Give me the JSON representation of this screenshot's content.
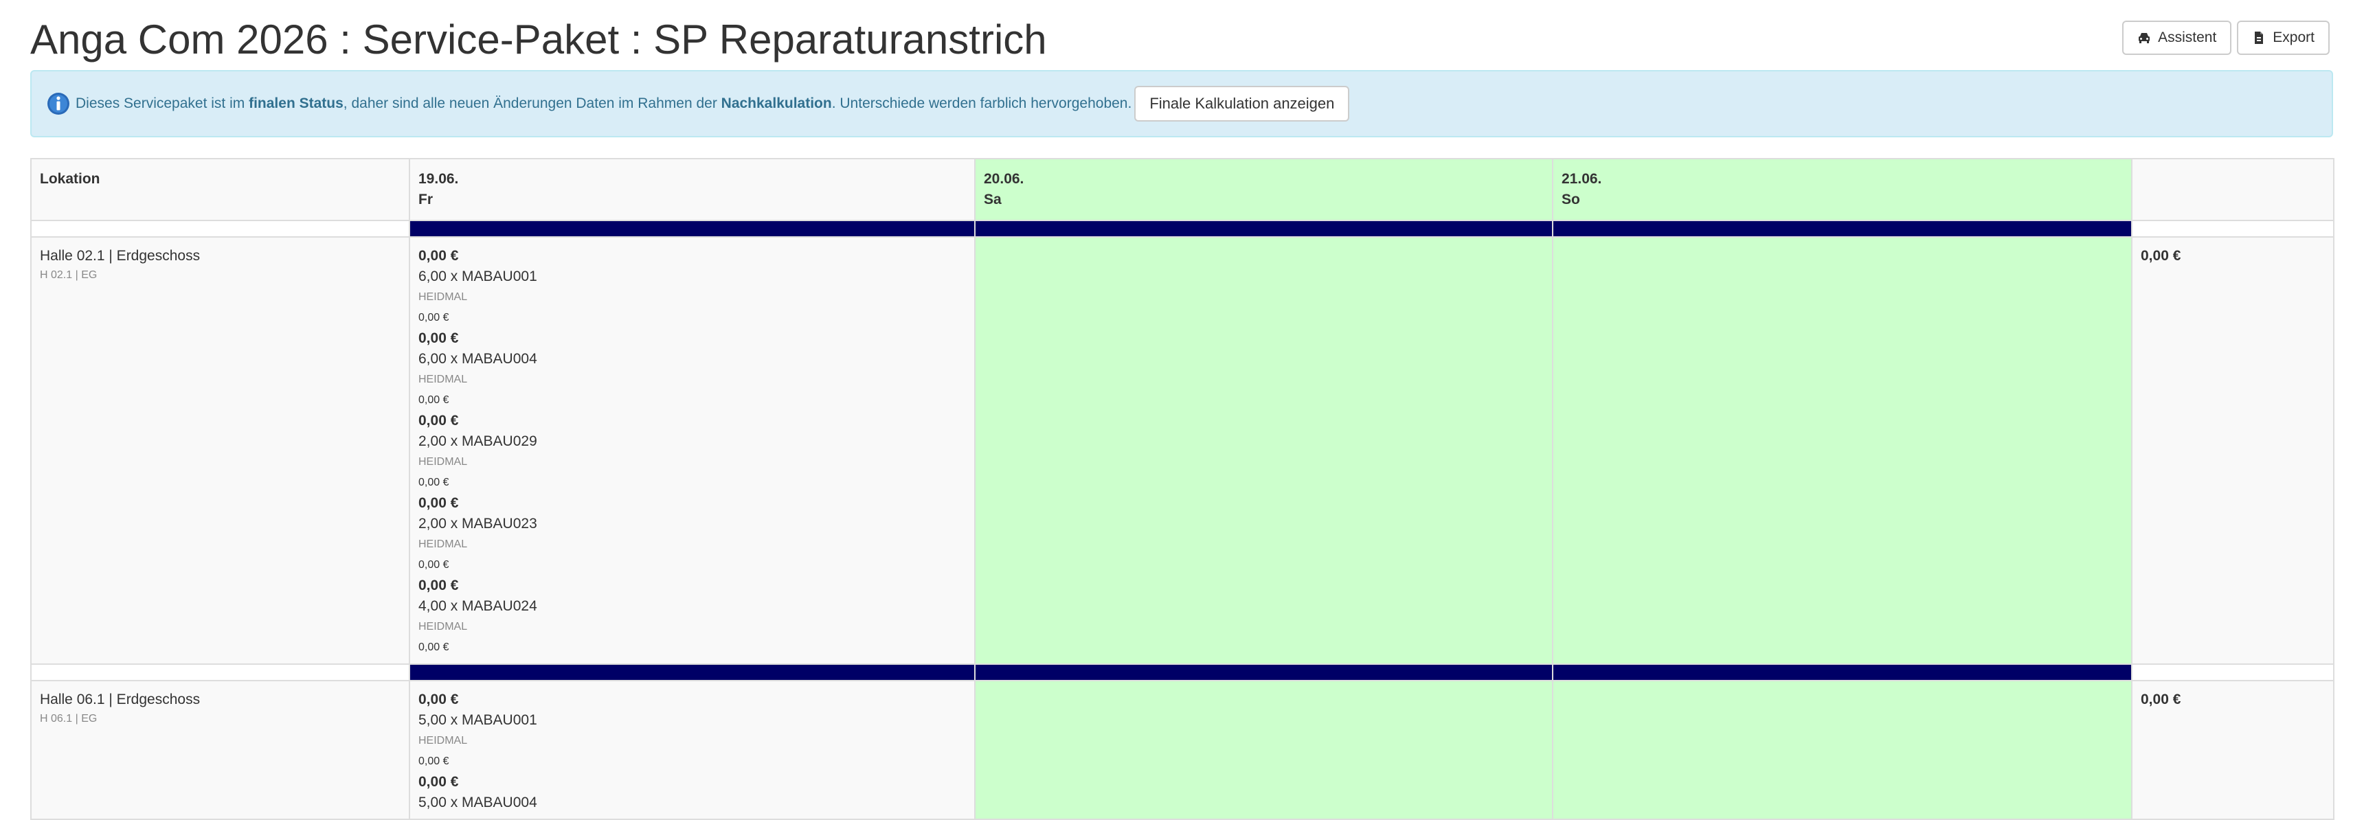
{
  "header": {
    "title": "Anga Com 2026 : Service-Paket : SP Reparaturanstrich",
    "buttons": [
      {
        "label": "Assistent",
        "icon": "car-icon"
      },
      {
        "label": "Export",
        "icon": "file-export-icon"
      }
    ]
  },
  "alert": {
    "icon": "info-icon",
    "text_1": "Dieses Servicepaket ist im ",
    "bold_1": "finalen Status",
    "text_2": ", daher sind alle neuen Änderungen Daten im Rahmen der ",
    "bold_2": "Nachkalkulation",
    "text_3": ". Unterschiede werden farblich hervorgehoben.",
    "button": "Finale Kalkulation anzeigen"
  },
  "table": {
    "location_header": "Lokation",
    "days": [
      {
        "date": "19.06.",
        "weekday": "Fr",
        "highlight": false
      },
      {
        "date": "20.06.",
        "weekday": "Sa",
        "highlight": true
      },
      {
        "date": "21.06.",
        "weekday": "So",
        "highlight": true
      }
    ],
    "colors": {
      "green": "#ccffcc",
      "bar": "#000066",
      "info_bg": "#d9edf7",
      "info_text": "#31708f"
    },
    "locations": [
      {
        "name": "Halle 02.1 | Erdgeschoss",
        "code": "H 02.1 | EG",
        "total": "0,00 €",
        "items": [
          {
            "price": "0,00 €",
            "qty": "6,00 x MABAU001",
            "vendor": "HEIDMAL",
            "sub": "0,00 €"
          },
          {
            "price": "0,00 €",
            "qty": "6,00 x MABAU004",
            "vendor": "HEIDMAL",
            "sub": "0,00 €"
          },
          {
            "price": "0,00 €",
            "qty": "2,00 x MABAU029",
            "vendor": "HEIDMAL",
            "sub": "0,00 €"
          },
          {
            "price": "0,00 €",
            "qty": "2,00 x MABAU023",
            "vendor": "HEIDMAL",
            "sub": "0,00 €"
          },
          {
            "price": "0,00 €",
            "qty": "4,00 x MABAU024",
            "vendor": "HEIDMAL",
            "sub": "0,00 €"
          }
        ]
      },
      {
        "name": "Halle 06.1 | Erdgeschoss",
        "code": "H 06.1 | EG",
        "total": "0,00 €",
        "items": [
          {
            "price": "0,00 €",
            "qty": "5,00 x MABAU001",
            "vendor": "HEIDMAL",
            "sub": "0,00 €"
          },
          {
            "price": "0,00 €",
            "qty": "5,00 x MABAU004",
            "vendor": "",
            "sub": ""
          }
        ]
      }
    ]
  }
}
